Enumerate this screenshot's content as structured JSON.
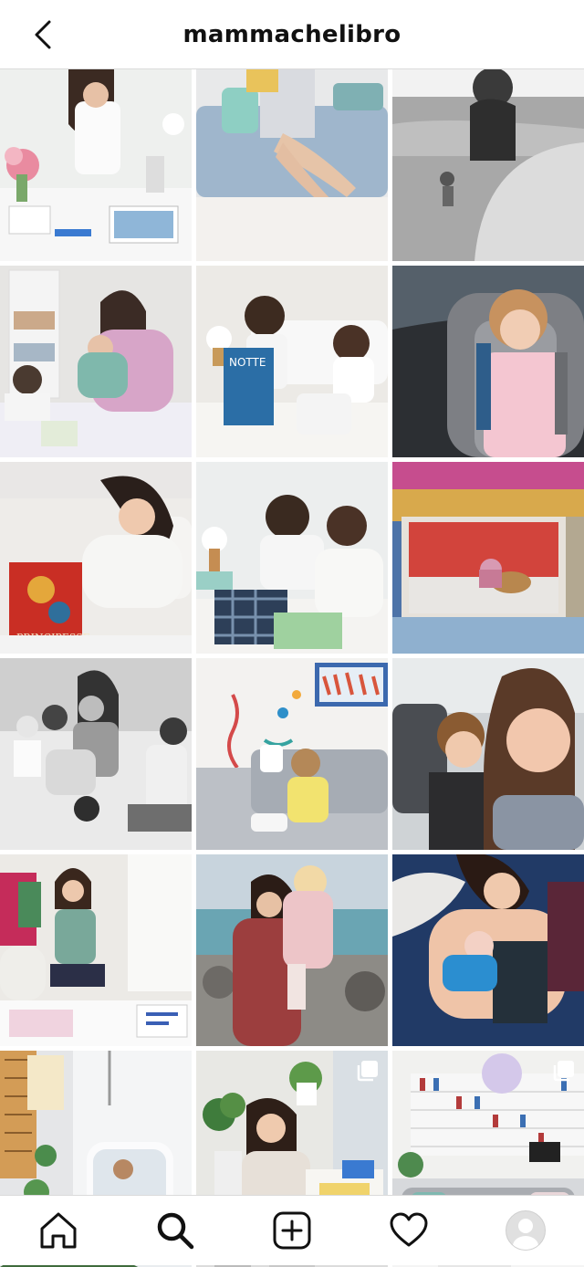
{
  "header": {
    "title": "mammachelibro",
    "back_icon": "chevron-left-icon"
  },
  "grid": {
    "posts": [
      {
        "name": "post-painting-desk",
        "scene": "painting-desk",
        "multi": false
      },
      {
        "name": "post-sofa-reading",
        "scene": "sofa-reading",
        "multi": false
      },
      {
        "name": "post-beach-bw",
        "scene": "beach-bw",
        "multi": false
      },
      {
        "name": "post-bed-family",
        "scene": "bed-family",
        "multi": false
      },
      {
        "name": "post-kids-book-bed",
        "scene": "kids-book-bed",
        "multi": false
      },
      {
        "name": "post-car-seat",
        "scene": "car-seat",
        "multi": false
      },
      {
        "name": "post-mom-red-book",
        "scene": "mom-red-book",
        "multi": false
      },
      {
        "name": "post-kids-pajamas",
        "scene": "kids-pajamas",
        "multi": false
      },
      {
        "name": "post-dog-window-frame",
        "scene": "dog-window-frame",
        "multi": false
      },
      {
        "name": "post-bed-bw",
        "scene": "bed-bw",
        "multi": false
      },
      {
        "name": "post-child-wall-art",
        "scene": "child-wall-art",
        "multi": false
      },
      {
        "name": "post-car-selfie",
        "scene": "car-selfie",
        "multi": false
      },
      {
        "name": "post-painting-floor",
        "scene": "painting-floor",
        "multi": false
      },
      {
        "name": "post-seaside-hug",
        "scene": "seaside-hug",
        "multi": false
      },
      {
        "name": "post-newborn",
        "scene": "newborn",
        "multi": false
      },
      {
        "name": "post-bathtub",
        "scene": "bathtub",
        "multi": false
      },
      {
        "name": "post-painter-table",
        "scene": "painter-table",
        "multi": true
      },
      {
        "name": "post-living-room",
        "scene": "living-room",
        "multi": true
      },
      {
        "name": "post-partial-1",
        "scene": "partial-palm",
        "multi": false,
        "partial": true
      },
      {
        "name": "post-partial-2",
        "scene": "partial-grey",
        "multi": false,
        "partial": true
      },
      {
        "name": "post-partial-3",
        "scene": "partial-light",
        "multi": false,
        "partial": true
      }
    ]
  },
  "nav": {
    "items": [
      {
        "name": "nav-home",
        "icon": "home-icon"
      },
      {
        "name": "nav-search",
        "icon": "search-icon"
      },
      {
        "name": "nav-new-post",
        "icon": "add-post-icon"
      },
      {
        "name": "nav-activity",
        "icon": "heart-icon"
      },
      {
        "name": "nav-profile",
        "icon": "profile-avatar-icon"
      }
    ]
  },
  "colors": {
    "divider": "#dbdbdb",
    "text": "#111111",
    "background": "#ffffff"
  }
}
